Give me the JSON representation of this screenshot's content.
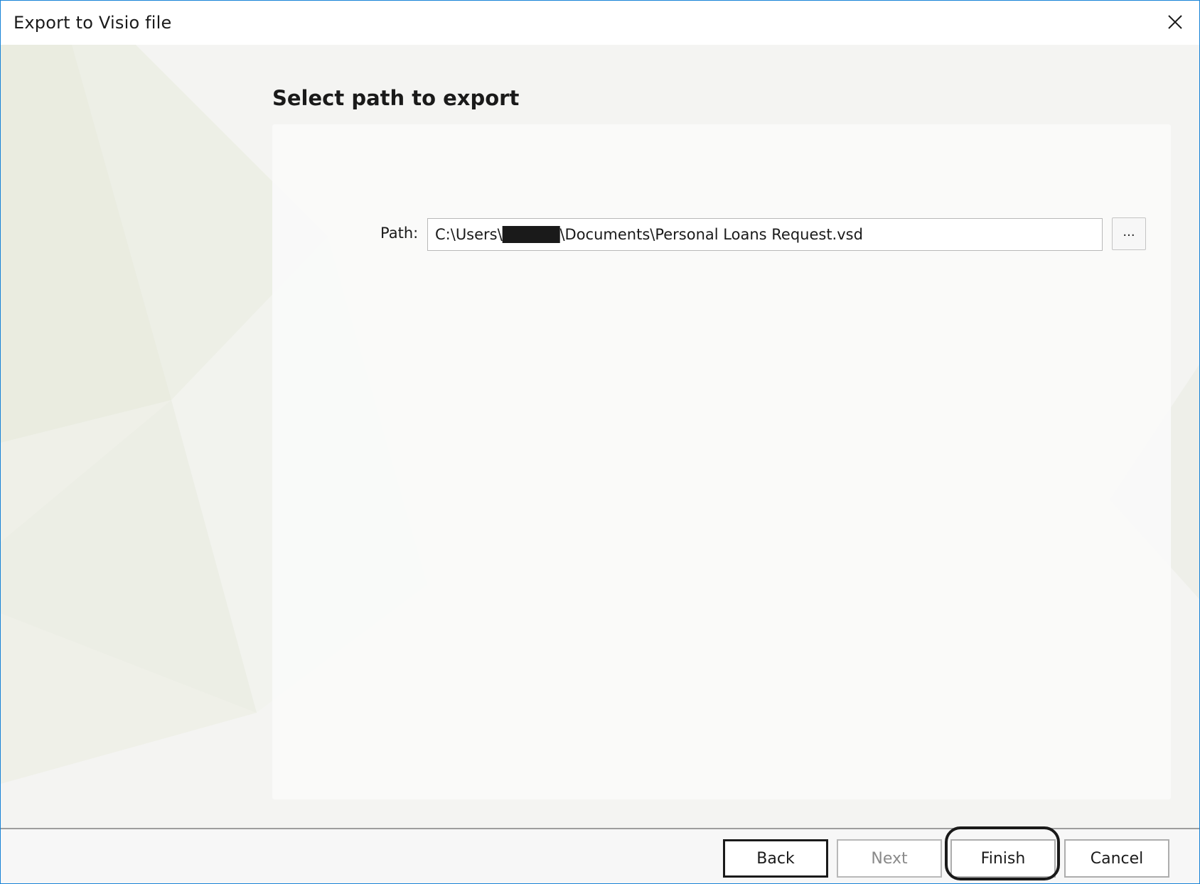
{
  "window": {
    "title": "Export to Visio file",
    "accent_color": "#1883d7"
  },
  "titlebar": {
    "close_icon": "close-icon"
  },
  "main": {
    "heading": "Select path to export",
    "path_label": "Path:",
    "path_value": "C:\\Users\\█████\\Documents\\Personal Loans Request.vsd",
    "browse_label": "..."
  },
  "footer": {
    "back_label": "Back",
    "next_label": "Next",
    "finish_label": "Finish",
    "cancel_label": "Cancel",
    "next_disabled": true
  }
}
